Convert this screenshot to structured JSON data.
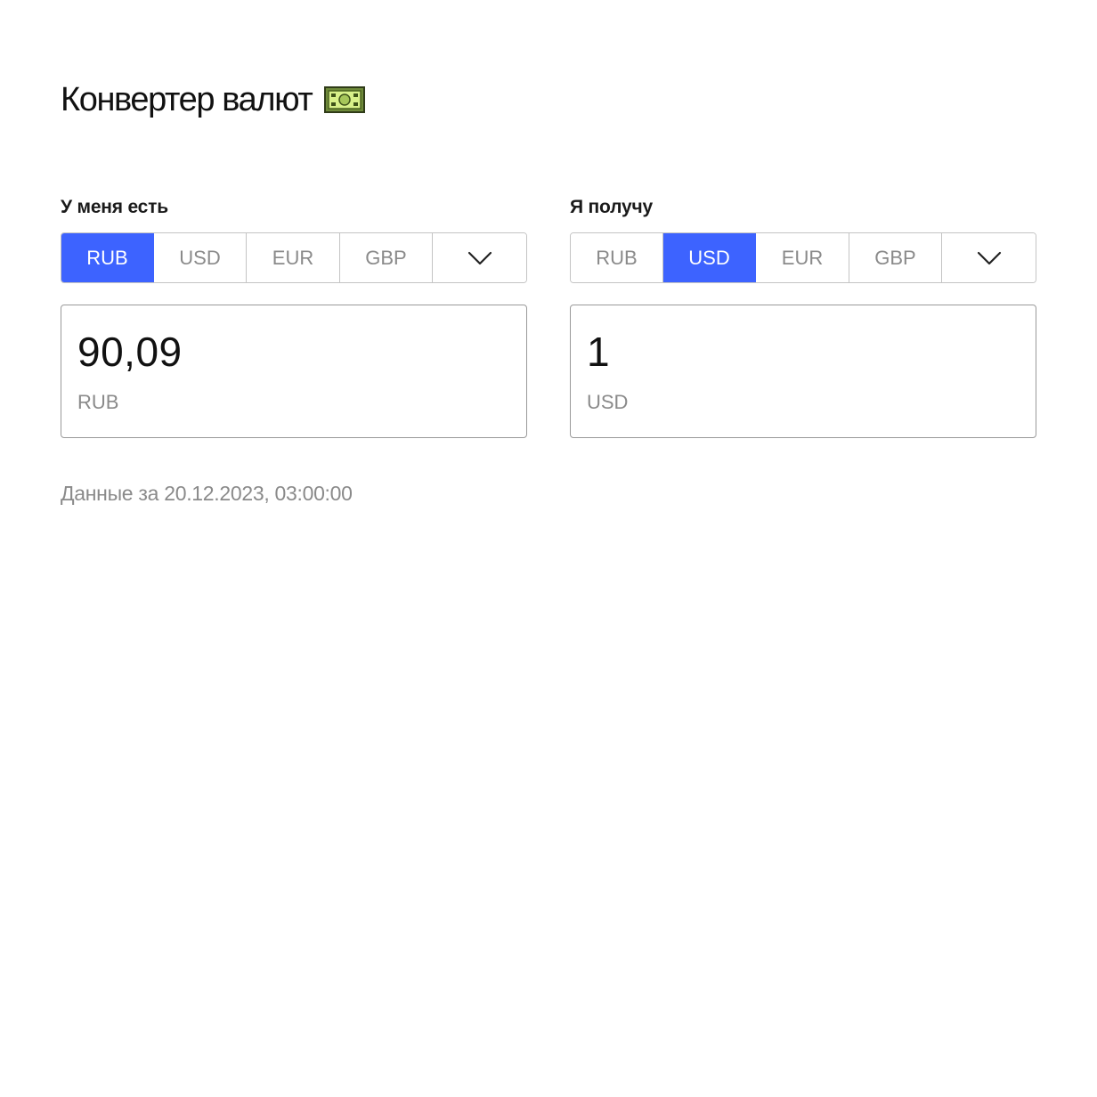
{
  "header": {
    "title": "Конвертер валют",
    "title_icon": "money-bill-icon"
  },
  "from_panel": {
    "label": "У меня есть",
    "tabs": [
      "RUB",
      "USD",
      "EUR",
      "GBP"
    ],
    "selected": "RUB",
    "dropdown_icon": "chevron-down-icon",
    "amount": "90,09",
    "currency": "RUB"
  },
  "to_panel": {
    "label": "Я получу",
    "tabs": [
      "RUB",
      "USD",
      "EUR",
      "GBP"
    ],
    "selected": "USD",
    "dropdown_icon": "chevron-down-icon",
    "amount": "1",
    "currency": "USD"
  },
  "footer": {
    "data_date": "Данные за 20.12.2023, 03:00:00"
  },
  "colors": {
    "accent": "#3d63ff",
    "muted_text": "#8a8a8a",
    "border": "#c4c4c4"
  }
}
